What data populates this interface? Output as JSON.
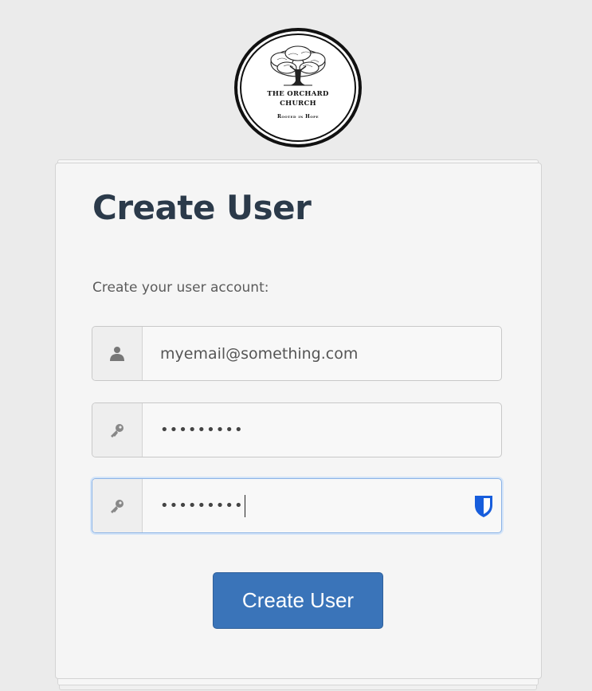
{
  "logo": {
    "line1": "THE ORCHARD",
    "line2": "CHURCH",
    "tagline": "Rooted in Hope",
    "icon": "tree-icon"
  },
  "form": {
    "title": "Create User",
    "subtitle": "Create your user account:",
    "email": {
      "value": "myemail@something.com",
      "icon": "user-icon"
    },
    "password": {
      "value": "•••••••••",
      "icon": "key-icon"
    },
    "confirm_password": {
      "value": "•••••••••",
      "icon": "key-icon",
      "extension_icon": "bitwarden-shield-icon"
    },
    "submit_label": "Create User"
  },
  "colors": {
    "title": "#2b3a4a",
    "button": "#3a74b9",
    "focus_border": "#8bb3e6",
    "bitwarden": "#175ddc"
  }
}
